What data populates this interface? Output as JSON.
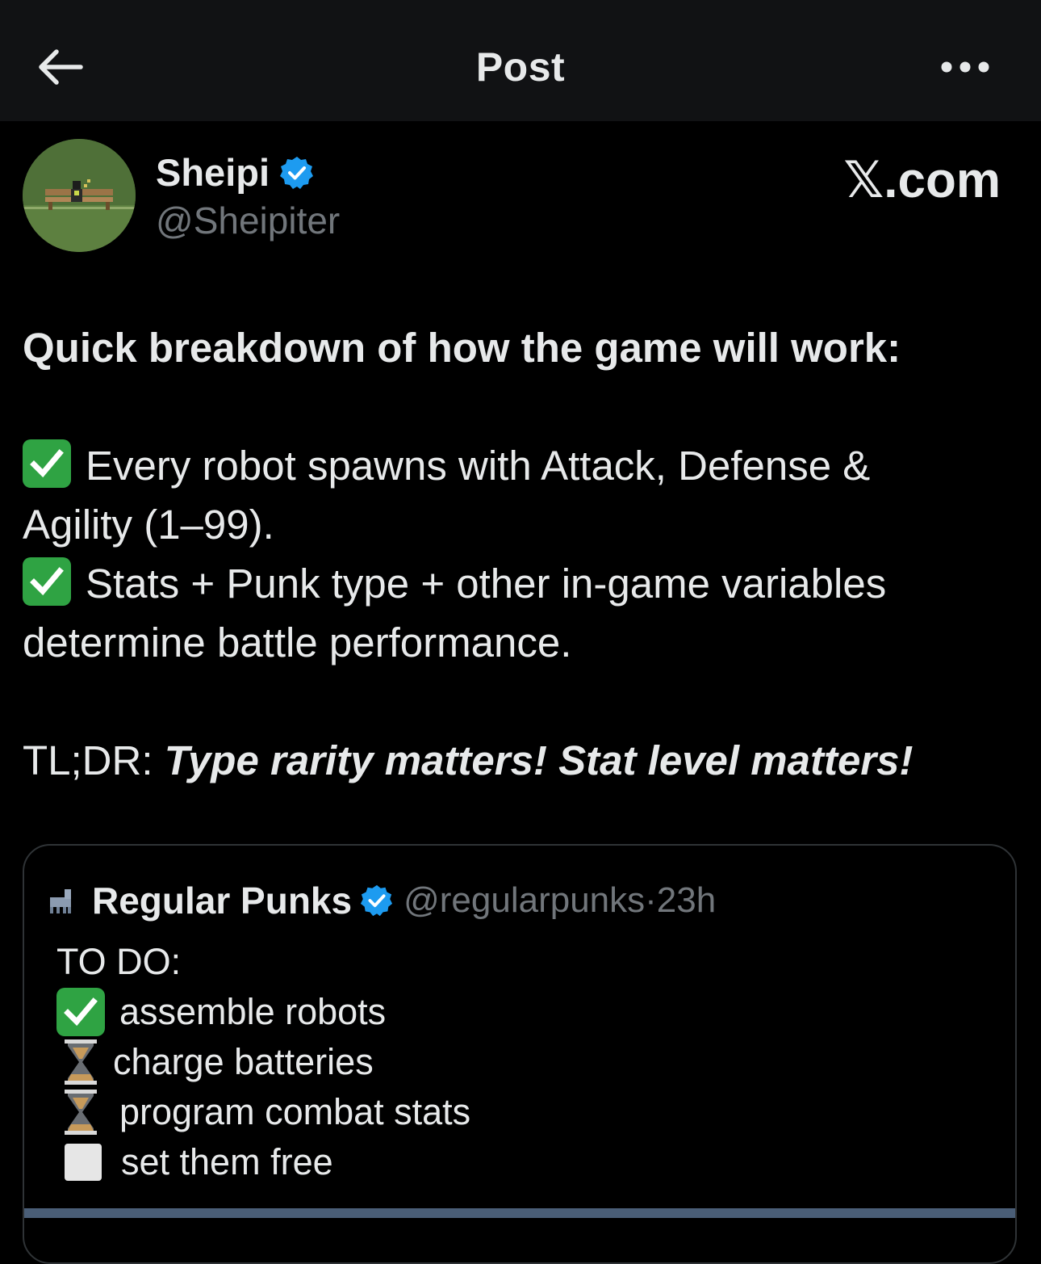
{
  "nav": {
    "title": "Post",
    "back_icon": "arrow-left-icon",
    "more_icon": "more-horizontal-icon"
  },
  "author": {
    "display_name": "Sheipi",
    "handle": "@Sheipiter",
    "verified": true,
    "watermark": "𝕏.com"
  },
  "post": {
    "heading": "Quick breakdown of how the game will work:",
    "line1": "Every robot spawns with Attack, Defense &",
    "line2": "Agility (1–99).",
    "line3": "Stats + Punk type + other in-game variables",
    "line4": "determine battle performance.",
    "tldr_prefix": "TL;DR: ",
    "tldr_emphasis": "Type rarity matters! Stat level matters!"
  },
  "quote": {
    "display_name": "Regular Punks",
    "handle": "@regularpunks",
    "separator": " · ",
    "time": "23h",
    "lines": {
      "todo": "TO DO:",
      "item1": "assemble robots",
      "item2": "charge batteries",
      "item3": "program combat stats",
      "item4": "set them free"
    }
  },
  "colors": {
    "background": "#000000",
    "topbar": "#111214",
    "text": "#e7e9ea",
    "secondary_text": "#71767b",
    "verified_blue": "#1d9bf0",
    "check_green": "#2fa343",
    "card_border": "#2f3336"
  }
}
